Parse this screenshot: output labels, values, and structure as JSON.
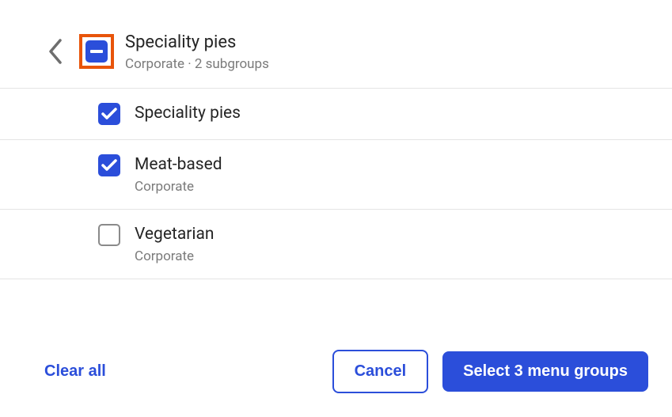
{
  "header": {
    "title": "Speciality pies",
    "subtitle": "Corporate · 2 subgroups",
    "checkbox_state": "indeterminate"
  },
  "items": [
    {
      "label": "Speciality pies",
      "sublabel": "",
      "state": "checked"
    },
    {
      "label": "Meat-based",
      "sublabel": "Corporate",
      "state": "checked"
    },
    {
      "label": "Vegetarian",
      "sublabel": "Corporate",
      "state": "unchecked"
    }
  ],
  "footer": {
    "clear_all": "Clear all",
    "cancel": "Cancel",
    "select": "Select 3 menu groups"
  },
  "colors": {
    "accent": "#2b4eda",
    "highlight_border": "#e8540a",
    "text_secondary": "#7a7a7a",
    "divider": "#e4e4e4"
  }
}
